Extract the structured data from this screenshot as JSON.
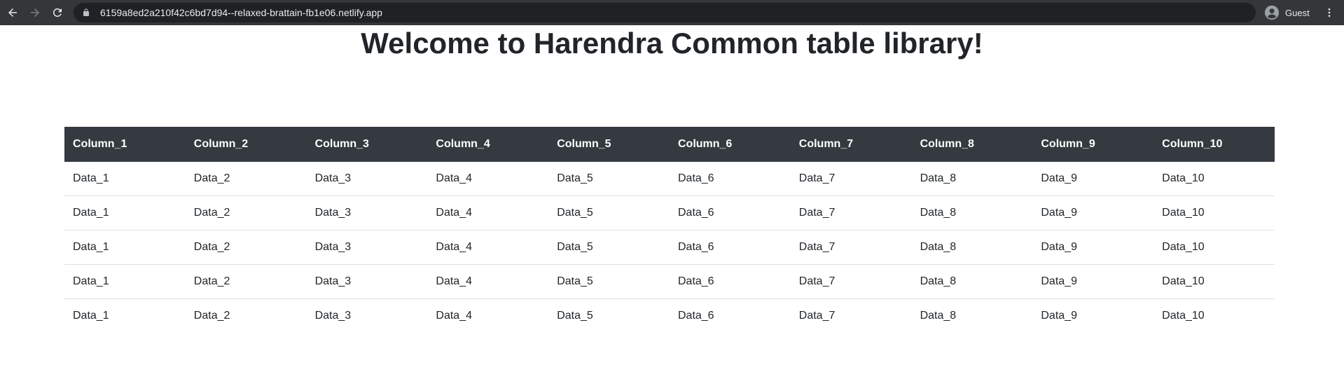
{
  "browser": {
    "url": "6159a8ed2a210f42c6bd7d94--relaxed-brattain-fb1e06.netlify.app",
    "profile_label": "Guest",
    "icons": [
      "back-icon",
      "forward-icon",
      "reload-icon",
      "lock-icon",
      "avatar-icon",
      "kebab-menu-icon"
    ]
  },
  "page": {
    "title": "Welcome to Harendra Common table library!"
  },
  "table": {
    "headers": [
      "Column_1",
      "Column_2",
      "Column_3",
      "Column_4",
      "Column_5",
      "Column_6",
      "Column_7",
      "Column_8",
      "Column_9",
      "Column_10"
    ],
    "rows": [
      [
        "Data_1",
        "Data_2",
        "Data_3",
        "Data_4",
        "Data_5",
        "Data_6",
        "Data_7",
        "Data_8",
        "Data_9",
        "Data_10"
      ],
      [
        "Data_1",
        "Data_2",
        "Data_3",
        "Data_4",
        "Data_5",
        "Data_6",
        "Data_7",
        "Data_8",
        "Data_9",
        "Data_10"
      ],
      [
        "Data_1",
        "Data_2",
        "Data_3",
        "Data_4",
        "Data_5",
        "Data_6",
        "Data_7",
        "Data_8",
        "Data_9",
        "Data_10"
      ],
      [
        "Data_1",
        "Data_2",
        "Data_3",
        "Data_4",
        "Data_5",
        "Data_6",
        "Data_7",
        "Data_8",
        "Data_9",
        "Data_10"
      ],
      [
        "Data_1",
        "Data_2",
        "Data_3",
        "Data_4",
        "Data_5",
        "Data_6",
        "Data_7",
        "Data_8",
        "Data_9",
        "Data_10"
      ]
    ]
  },
  "colors": {
    "header_bg": "#343a40",
    "header_text": "#ffffff",
    "browser_bar": "#35363a",
    "omnibox": "#202124"
  }
}
